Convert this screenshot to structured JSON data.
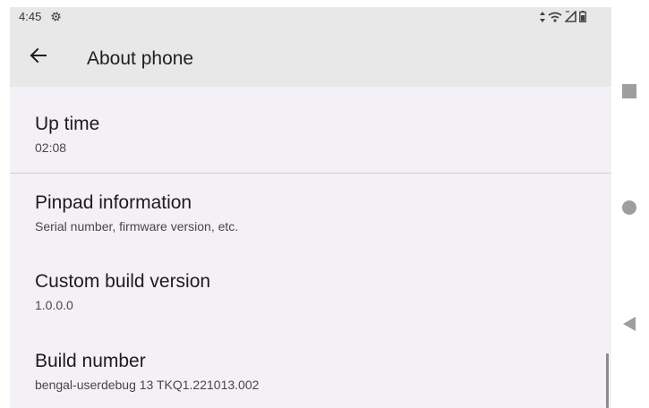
{
  "status_bar": {
    "time": "4:45",
    "icons": [
      "settings-gear-icon",
      "data-arrows-icon",
      "wifi-icon",
      "signal-icon",
      "battery-icon"
    ]
  },
  "app_bar": {
    "title": "About phone",
    "back_icon": "arrow-left-icon"
  },
  "items": [
    {
      "title": "Up time",
      "subtitle": "02:08"
    },
    {
      "title": "Pinpad information",
      "subtitle": "Serial number, firmware version, etc."
    },
    {
      "title": "Custom build version",
      "subtitle": "1.0.0.0"
    },
    {
      "title": "Build number",
      "subtitle": "bengal-userdebug 13 TKQ1.221013.002"
    }
  ],
  "nav_bar": {
    "icons": [
      "recents-square-icon",
      "home-circle-icon",
      "back-triangle-icon"
    ]
  },
  "colors": {
    "app_bar_bg": "#e8e8e8",
    "content_bg": "#f3f1f6",
    "title_text": "#1d1b20",
    "subtitle_text": "#49454f",
    "nav_icon": "#9e9e9e"
  }
}
